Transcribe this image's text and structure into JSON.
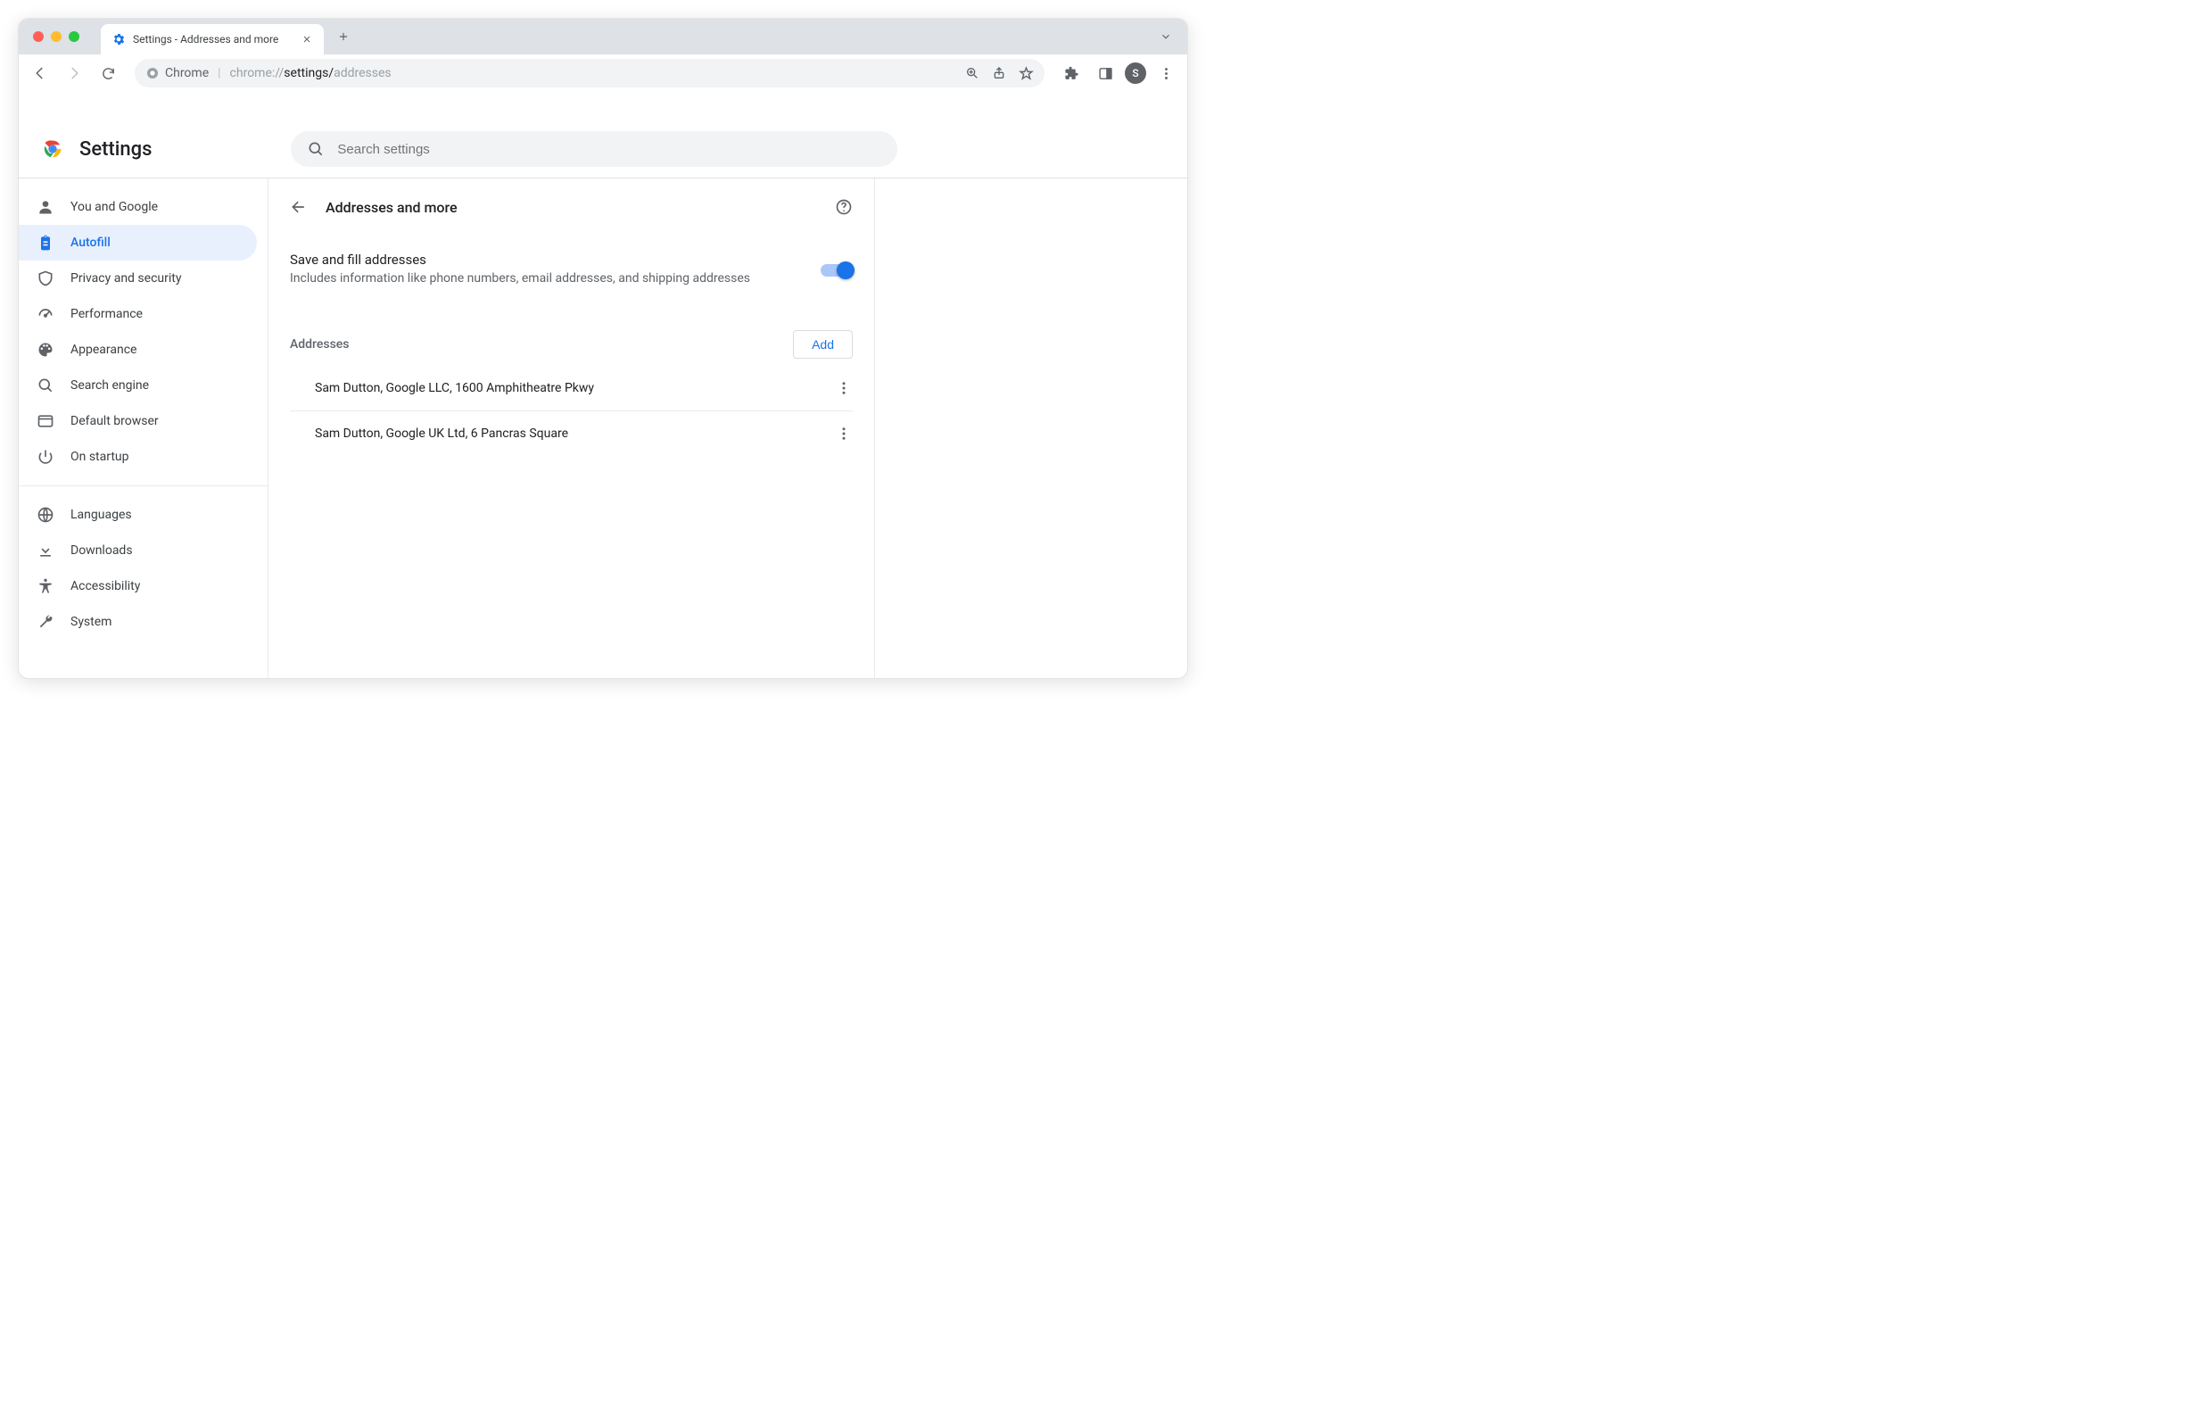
{
  "browser": {
    "tab_title": "Settings - Addresses and more",
    "omnibox_chip": "Chrome",
    "url_prefix": "chrome://",
    "url_mid": "settings/",
    "url_tail": "addresses",
    "avatar_initial": "S"
  },
  "header": {
    "title": "Settings",
    "search_placeholder": "Search settings"
  },
  "sidebar": {
    "primary": [
      {
        "icon": "person",
        "label": "You and Google"
      },
      {
        "icon": "clipboard",
        "label": "Autofill",
        "active": true
      },
      {
        "icon": "shield",
        "label": "Privacy and security"
      },
      {
        "icon": "speed",
        "label": "Performance"
      },
      {
        "icon": "palette",
        "label": "Appearance"
      },
      {
        "icon": "search",
        "label": "Search engine"
      },
      {
        "icon": "browser",
        "label": "Default browser"
      },
      {
        "icon": "power",
        "label": "On startup"
      }
    ],
    "secondary": [
      {
        "icon": "globe",
        "label": "Languages"
      },
      {
        "icon": "download",
        "label": "Downloads"
      },
      {
        "icon": "accessibility",
        "label": "Accessibility"
      },
      {
        "icon": "wrench",
        "label": "System"
      }
    ]
  },
  "panel": {
    "title": "Addresses and more",
    "toggle": {
      "title": "Save and fill addresses",
      "subtitle": "Includes information like phone numbers, email addresses, and shipping addresses",
      "on": true
    },
    "list_label": "Addresses",
    "add_label": "Add",
    "addresses": [
      "Sam Dutton, Google LLC, 1600 Amphitheatre Pkwy",
      "Sam Dutton, Google UK Ltd, 6 Pancras Square"
    ]
  }
}
